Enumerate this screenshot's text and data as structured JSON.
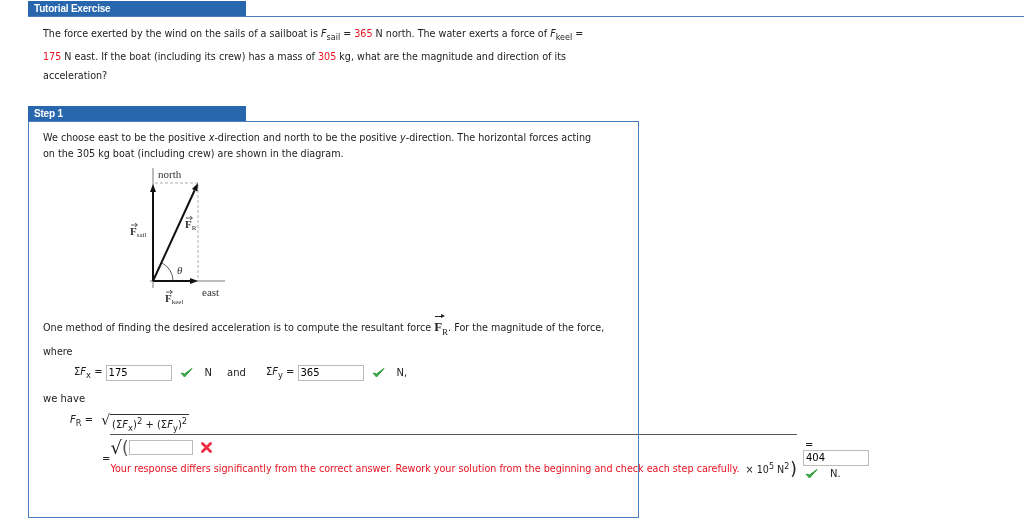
{
  "exercise": {
    "title": "Tutorial Exercise",
    "problem": [
      {
        "kind": "text",
        "text": "The force exerted by the wind on the sails of a sailboat is *F*$_{sail}$ = "
      },
      {
        "kind": "value",
        "text": "365"
      },
      {
        "kind": "text",
        "text": " N north. The water exerts a force of *F*$_{keel}$ = "
      },
      {
        "kind": "value",
        "text": "175"
      },
      {
        "kind": "text",
        "text": " N east. If the boat (including its crew) has a mass of "
      },
      {
        "kind": "value",
        "text": "305"
      },
      {
        "kind": "text",
        "text": " kg, what are the magnitude and direction of its acceleration?"
      }
    ]
  },
  "step": {
    "title": "Step 1",
    "intro": "We choose east to be the positive *x*-direction and north to be the positive *y*-direction. The horizontal forces acting on the 305 kg boat (including crew) are shown in the diagram.",
    "diagram": {
      "north": "north",
      "east": "east",
      "angle": "θ",
      "forces": [
        {
          "kind": "sail",
          "main": "F",
          "sub": "sail"
        },
        {
          "kind": "resultant",
          "main": "F",
          "sub": "R"
        },
        {
          "kind": "keel",
          "main": "F",
          "sub": "keel"
        }
      ]
    },
    "method": {
      "before": "One method of finding the desired acceleration is to compute the resultant force ",
      "vector": {
        "main": "F",
        "sub": "R"
      },
      "after": ". For the magnitude of the force, where"
    },
    "components": [
      {
        "sigma": "Σ",
        "label": "*F*$_{x}$ =",
        "value": "175",
        "correct": true,
        "unit": "N"
      },
      {
        "sigma": "Σ",
        "label": "*F*$_{y}$ =",
        "value": "365",
        "correct": true,
        "unit": "N,"
      }
    ],
    "joiner": "and",
    "we_have": "we have",
    "formula": {
      "lhs": "*F*$_{R}$ =",
      "radical": "√",
      "radicand": [
        "(Σ",
        "*F*$_{x}$",
        ")$^{2}$ + (Σ",
        "*F*$_{y}$",
        ")$^{2}$"
      ]
    },
    "answer": {
      "equals": "=",
      "radical": "√",
      "open": "(",
      "correct": false,
      "feedback": "Your response differs significantly from the correct answer. Rework your solution from the beginning and check each step carefully.",
      "factor": "× 10$^{5}$ N$^{2}$",
      "close": ")",
      "result": {
        "equals": "=",
        "value": "404",
        "correct": true,
        "unit": "N."
      }
    }
  }
}
